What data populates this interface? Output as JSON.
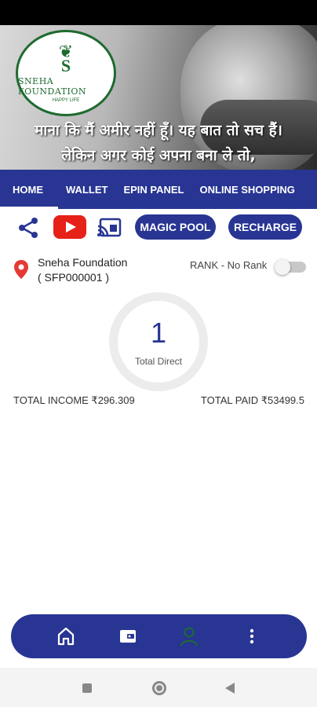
{
  "banner": {
    "logo_name": "SNEHA FOUNDATION",
    "logo_tagline": "HAPPY LIFE",
    "logo_letter": "S",
    "quote_line1": "माना कि मैं अमीर नहीं हूँ। यह बात तो सच हैं।",
    "quote_line2": "लेकिन अगर कोई अपना बना ले तो,"
  },
  "tabs": [
    {
      "label": "HOME",
      "active": true
    },
    {
      "label": "WALLET",
      "active": false
    },
    {
      "label": "EPIN PANEL",
      "active": false
    },
    {
      "label": "ONLINE SHOPPING",
      "active": false
    }
  ],
  "actions": {
    "magic_pool_label": "MAGIC POOL",
    "recharge_label": "RECHARGE"
  },
  "profile": {
    "name": "Sneha Foundation",
    "id": "( SFP000001 )",
    "rank": "RANK - No Rank"
  },
  "stats": {
    "direct_count": "1",
    "direct_label": "Total Direct",
    "total_income": "TOTAL INCOME ₹296.309",
    "total_paid": "TOTAL PAID ₹53499.5"
  },
  "colors": {
    "primary": "#283593",
    "youtube": "#e62117",
    "pin": "#e53935",
    "logo_green": "#1e6b2f"
  },
  "icons": {
    "share": "share-icon",
    "youtube": "youtube-icon",
    "cast": "cast-icon",
    "location": "location-pin-icon",
    "home": "home-icon",
    "wallet": "wallet-icon",
    "user": "user-icon",
    "more": "more-vertical-icon"
  }
}
